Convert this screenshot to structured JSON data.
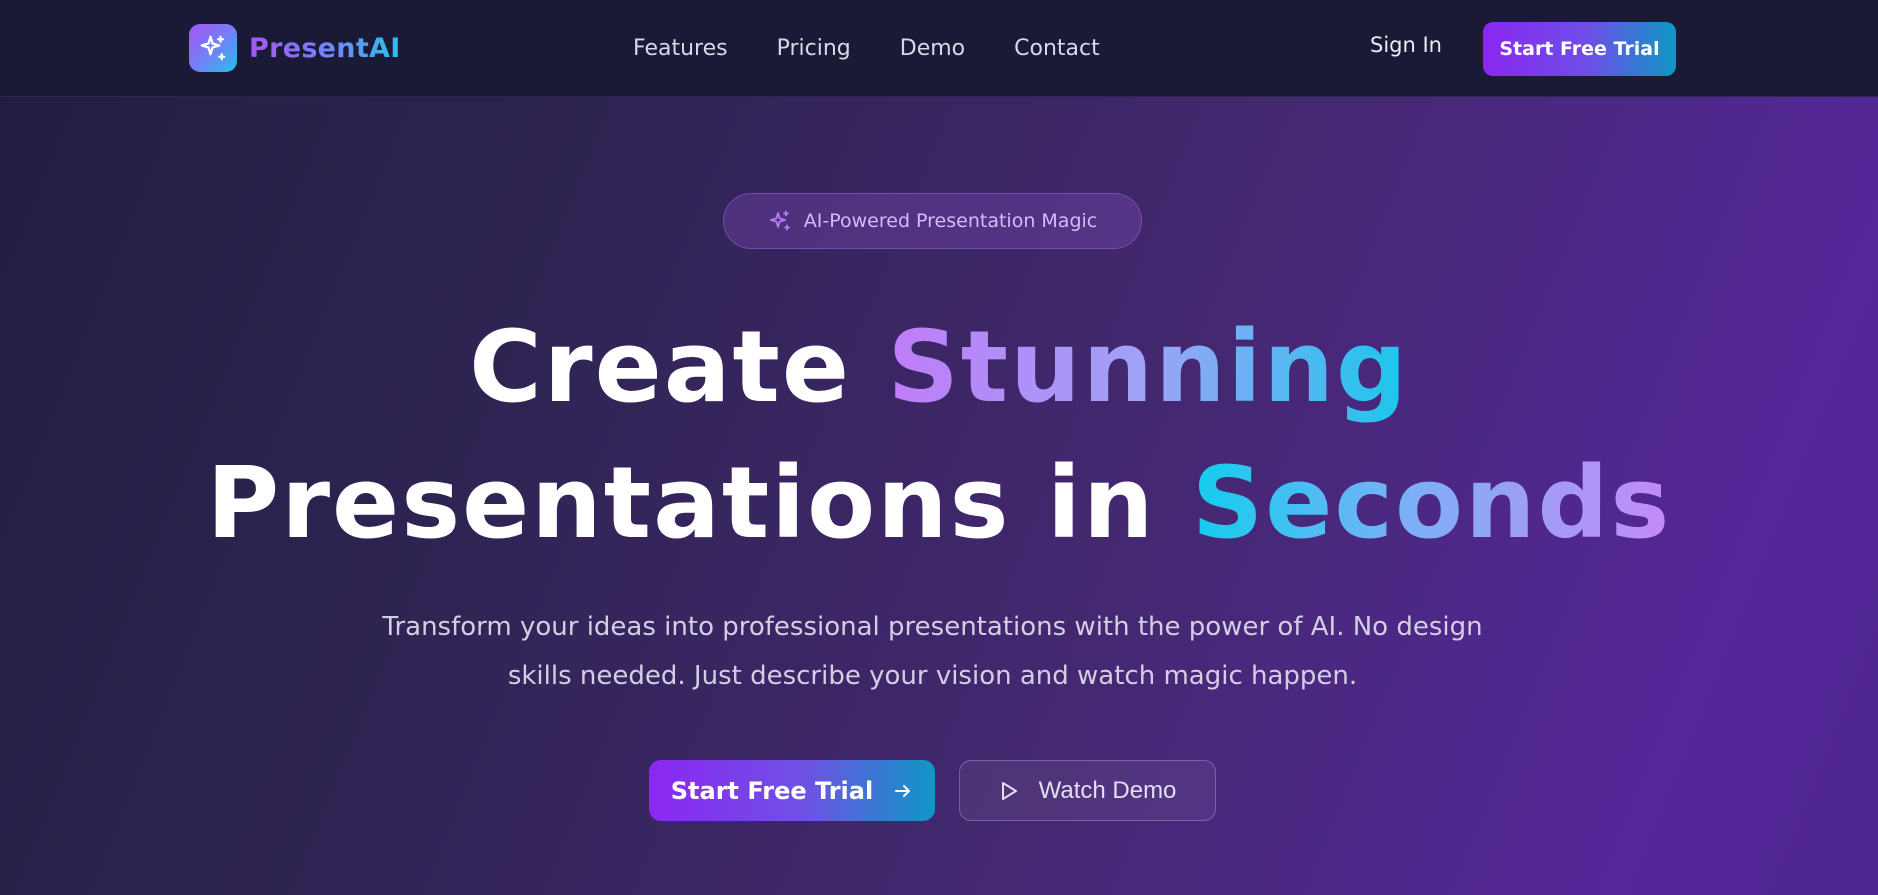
{
  "brand": {
    "name": "PresentAI",
    "logo_icon": "sparkles-icon"
  },
  "nav": {
    "links": [
      {
        "label": "Features"
      },
      {
        "label": "Pricing"
      },
      {
        "label": "Demo"
      },
      {
        "label": "Contact"
      }
    ],
    "sign_in": "Sign In",
    "cta": "Start Free Trial"
  },
  "hero": {
    "badge": {
      "icon": "sparkles-icon",
      "label": "AI-Powered Presentation Magic"
    },
    "headline": {
      "line1_plain": "Create",
      "line1_accent": "Stunning",
      "line2_plain": "Presentations in",
      "line2_accent": "Seconds"
    },
    "subtext": "Transform your ideas into professional presentations with the power of AI. No design skills needed. Just describe your vision and watch magic happen.",
    "primary_cta": {
      "label": "Start Free Trial",
      "icon": "arrow-right-icon"
    },
    "secondary_cta": {
      "label": "Watch Demo",
      "icon": "play-icon"
    }
  },
  "colors": {
    "accent_purple": "#8b27f2",
    "accent_cyan": "#0e98c5",
    "nav_bg": "#1a1a36"
  }
}
